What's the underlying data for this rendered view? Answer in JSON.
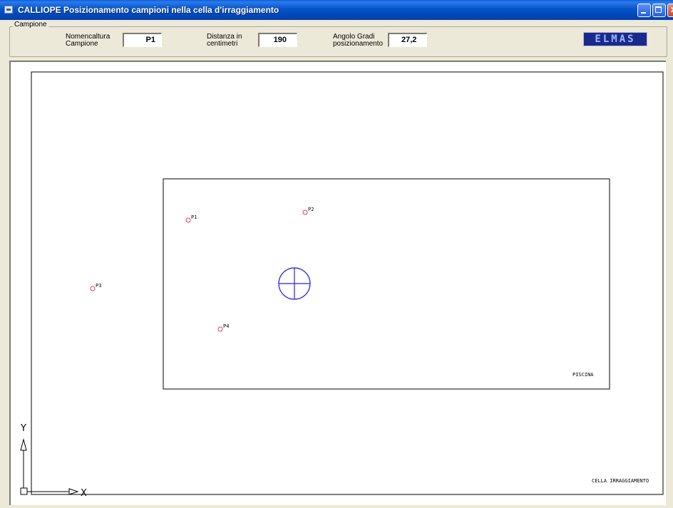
{
  "window": {
    "title": "CALLIOPE  Posizionamento campioni nella cella d'irraggiamento"
  },
  "campione": {
    "group_label": "Campione",
    "nomenclatura": {
      "label_line1": "Nomencaltura",
      "label_line2": "Campione",
      "value": "P1"
    },
    "distanza": {
      "label_line1": "Distanza in",
      "label_line2": "centimetri",
      "value": "190"
    },
    "angolo": {
      "label_line1": "Angolo Gradi",
      "label_line2": "posizionamento",
      "value": "27,2"
    }
  },
  "logo": {
    "text": "ELMAS"
  },
  "drawing": {
    "inner_rect_label": "PISCINA",
    "outer_rect_label": "CELLA IRRAGGIAMENTO",
    "axis_x_label": "X",
    "axis_y_label": "Y",
    "samples": [
      {
        "name": "P1"
      },
      {
        "name": "P2"
      },
      {
        "name": "P3"
      },
      {
        "name": "P4"
      }
    ],
    "colors": {
      "sample": "#e0404a",
      "source": "#2020e0",
      "lines": "#000000",
      "axes": "#000000"
    }
  }
}
